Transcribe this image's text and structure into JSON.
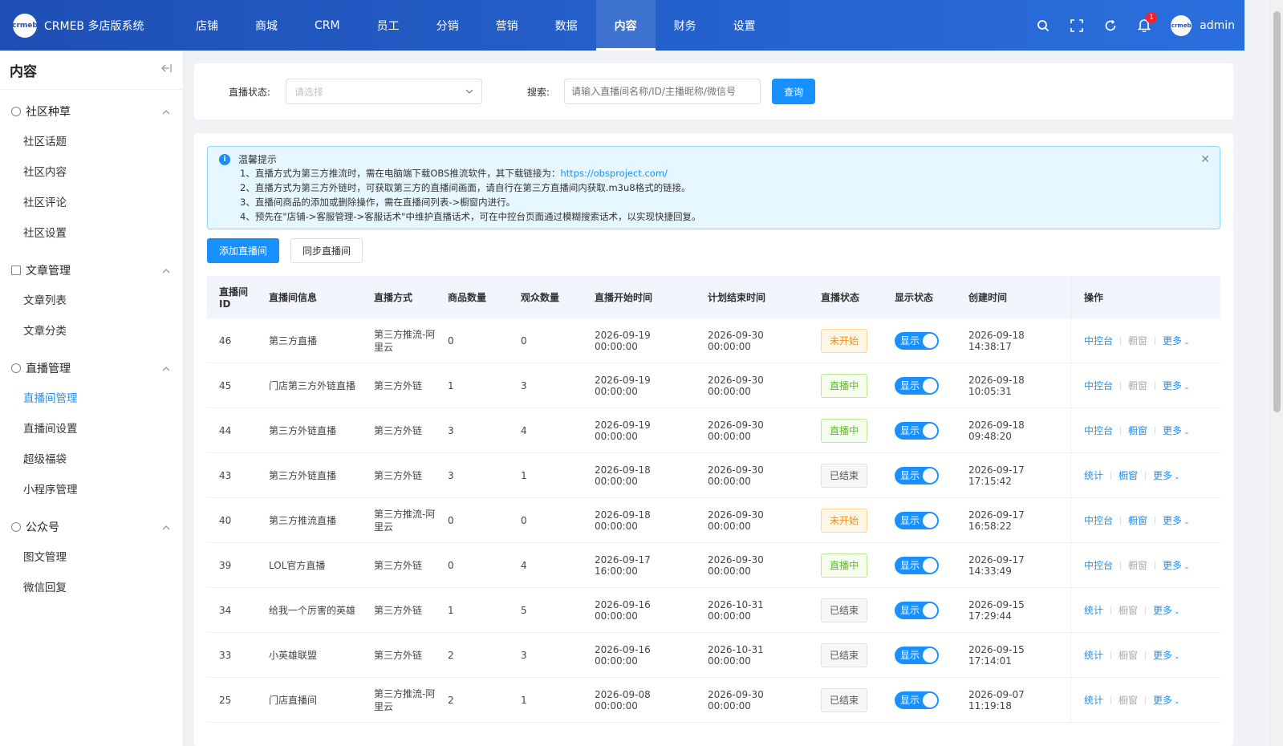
{
  "app": {
    "logo_text": "crmeb",
    "title": "CRMEB 多店版系统"
  },
  "topnav": [
    "店铺",
    "商城",
    "CRM",
    "员工",
    "分销",
    "营销",
    "数据",
    "内容",
    "财务",
    "设置"
  ],
  "topnav_active_index": 7,
  "notifications": {
    "count": "1"
  },
  "user": {
    "name": "admin",
    "avatar_text": "crmeb"
  },
  "sidebar": {
    "title": "内容",
    "groups": [
      {
        "label": "社区种草",
        "items": [
          "社区话题",
          "社区内容",
          "社区评论",
          "社区设置"
        ]
      },
      {
        "label": "文章管理",
        "items": [
          "文章列表",
          "文章分类"
        ]
      },
      {
        "label": "直播管理",
        "items": [
          "直播间管理",
          "直播间设置",
          "超级福袋",
          "小程序管理"
        ]
      },
      {
        "label": "公众号",
        "items": [
          "图文管理",
          "微信回复"
        ]
      }
    ],
    "active_item": "直播间管理"
  },
  "filter": {
    "status_label": "直播状态:",
    "status_placeholder": "请选择",
    "search_label": "搜索:",
    "search_placeholder": "请输入直播间名称/ID/主播昵称/微信号",
    "query_button": "查询"
  },
  "alert": {
    "title": "温馨提示",
    "line1": "1、直播方式为第三方推流时，需在电脑端下载OBS推流软件，其下载链接为：",
    "line1_link": "https://obsproject.com/",
    "line2": "2、直播方式为第三方外链时，可获取第三方的直播间画面，请自行在第三方直播间内获取.m3u8格式的链接。",
    "line3": "3、直播间商品的添加或删除操作，需在直播间列表->橱窗内进行。",
    "line4": "4、预先在\"店铺->客服管理->客服话术\"中维护直播话术，可在中控台页面通过模糊搜索话术，以实现快捷回复。"
  },
  "buttons": {
    "add": "添加直播间",
    "sync": "同步直播间"
  },
  "table": {
    "headers": [
      "直播间ID",
      "直播间信息",
      "直播方式",
      "商品数量",
      "观众数量",
      "直播开始时间",
      "计划结束时间",
      "直播状态",
      "显示状态",
      "创建时间",
      "操作"
    ],
    "rows": [
      {
        "id": "46",
        "name": "第三方直播",
        "mode": "第三方推流-阿里云",
        "goods": "0",
        "viewers": "0",
        "start": "2026-09-19 00:00:00",
        "end": "2026-09-30 00:00:00",
        "status": "未开始",
        "status_type": "notstart",
        "show": "显示",
        "created": "2026-09-18 14:38:17",
        "op1": "中控台",
        "op2": "橱窗",
        "op2_enabled": false,
        "op3": "更多"
      },
      {
        "id": "45",
        "name": "门店第三方外链直播",
        "mode": "第三方外链",
        "goods": "1",
        "viewers": "3",
        "start": "2026-09-19 00:00:00",
        "end": "2026-09-30 00:00:00",
        "status": "直播中",
        "status_type": "live",
        "show": "显示",
        "created": "2026-09-18 10:05:31",
        "op1": "中控台",
        "op2": "橱窗",
        "op2_enabled": false,
        "op3": "更多"
      },
      {
        "id": "44",
        "name": "第三方外链直播",
        "mode": "第三方外链",
        "goods": "3",
        "viewers": "4",
        "start": "2026-09-19 00:00:00",
        "end": "2026-09-30 00:00:00",
        "status": "直播中",
        "status_type": "live",
        "show": "显示",
        "created": "2026-09-18 09:48:20",
        "op1": "中控台",
        "op2": "橱窗",
        "op2_enabled": true,
        "op3": "更多"
      },
      {
        "id": "43",
        "name": "第三方外链直播",
        "mode": "第三方外链",
        "goods": "3",
        "viewers": "1",
        "start": "2026-09-18 00:00:00",
        "end": "2026-09-30 00:00:00",
        "status": "已结束",
        "status_type": "ended",
        "show": "显示",
        "created": "2026-09-17 17:15:42",
        "op1": "统计",
        "op2": "橱窗",
        "op2_enabled": true,
        "op3": "更多"
      },
      {
        "id": "40",
        "name": "第三方推流直播",
        "mode": "第三方推流-阿里云",
        "goods": "0",
        "viewers": "0",
        "start": "2026-09-18 00:00:00",
        "end": "2026-09-30 00:00:00",
        "status": "未开始",
        "status_type": "notstart",
        "show": "显示",
        "created": "2026-09-17 16:58:22",
        "op1": "中控台",
        "op2": "橱窗",
        "op2_enabled": true,
        "op3": "更多"
      },
      {
        "id": "39",
        "name": "LOL官方直播",
        "mode": "第三方外链",
        "goods": "0",
        "viewers": "4",
        "start": "2026-09-17 16:00:00",
        "end": "2026-09-30 00:00:00",
        "status": "直播中",
        "status_type": "live",
        "show": "显示",
        "created": "2026-09-17 14:33:49",
        "op1": "中控台",
        "op2": "橱窗",
        "op2_enabled": false,
        "op3": "更多"
      },
      {
        "id": "34",
        "name": "给我一个厉害的英雄",
        "mode": "第三方外链",
        "goods": "1",
        "viewers": "5",
        "start": "2026-09-16 00:00:00",
        "end": "2026-10-31 00:00:00",
        "status": "已结束",
        "status_type": "ended",
        "show": "显示",
        "created": "2026-09-15 17:29:44",
        "op1": "统计",
        "op2": "橱窗",
        "op2_enabled": false,
        "op3": "更多"
      },
      {
        "id": "33",
        "name": "小英雄联盟",
        "mode": "第三方外链",
        "goods": "2",
        "viewers": "3",
        "start": "2026-09-16 00:00:00",
        "end": "2026-10-31 00:00:00",
        "status": "已结束",
        "status_type": "ended",
        "show": "显示",
        "created": "2026-09-15 17:14:01",
        "op1": "统计",
        "op2": "橱窗",
        "op2_enabled": false,
        "op3": "更多"
      },
      {
        "id": "25",
        "name": "门店直播间",
        "mode": "第三方推流-阿里云",
        "goods": "2",
        "viewers": "1",
        "start": "2026-09-08 00:00:00",
        "end": "2026-09-30 00:00:00",
        "status": "已结束",
        "status_type": "ended",
        "show": "显示",
        "created": "2026-09-07 11:19:18",
        "op1": "统计",
        "op2": "橱窗",
        "op2_enabled": false,
        "op3": "更多"
      }
    ]
  }
}
